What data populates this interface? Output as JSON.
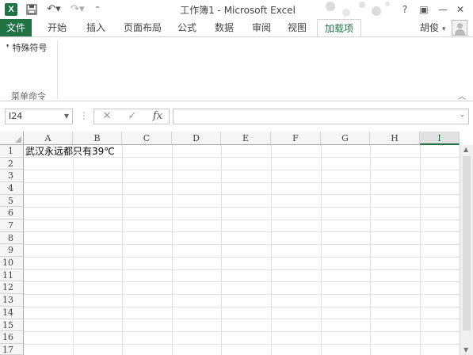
{
  "title_bar": {
    "app_icon_letter": "X",
    "window_title": "工作簿1 - Microsoft Excel",
    "help_label": "?",
    "window_buttons": [
      "?",
      "▣",
      "—",
      "▢",
      "✕"
    ]
  },
  "tabs": {
    "file": "文件",
    "items": [
      "开始",
      "插入",
      "页面布局",
      "公式",
      "数据",
      "审阅",
      "视图",
      "加载项"
    ],
    "active": "加载项",
    "user_name": "胡俊"
  },
  "ribbon": {
    "item_label": "特殊符号",
    "group_label": "菜单命令"
  },
  "formula_bar": {
    "name_box": "I24",
    "formula_value": ""
  },
  "sheet": {
    "columns": [
      "A",
      "B",
      "C",
      "D",
      "E",
      "F",
      "G",
      "H",
      "I"
    ],
    "selected_column": "I",
    "rows": [
      "1",
      "2",
      "3",
      "4",
      "5",
      "6",
      "7",
      "8",
      "9",
      "10",
      "11",
      "12",
      "13",
      "14",
      "15",
      "16",
      "17"
    ],
    "cell_A1": "武汉永远都只有39℃"
  },
  "colors": {
    "accent": "#217346",
    "header_bg": "#f5f5f5",
    "gridline": "#d4d4d4"
  }
}
